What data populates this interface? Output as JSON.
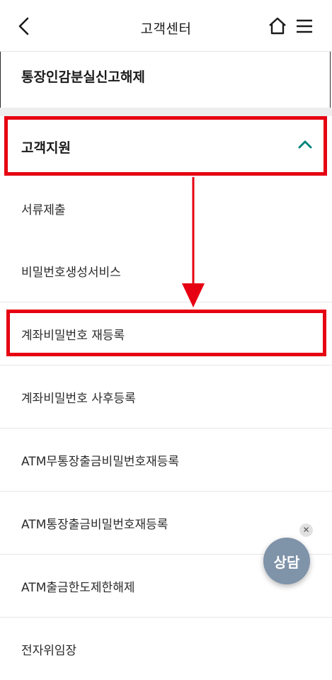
{
  "header": {
    "title": "고객센터",
    "back_icon": "chevron-left-icon",
    "home_icon": "home-icon",
    "menu_icon": "hamburger-menu-icon"
  },
  "previous_item": {
    "label": "통장인감분실신고해제"
  },
  "section": {
    "title": "고객지원",
    "toggle_icon": "chevron-up-icon",
    "accent_color": "#00857c"
  },
  "items": [
    {
      "label": "서류제출"
    },
    {
      "label": "비밀번호생성서비스"
    },
    {
      "label": "계좌비밀번호 재등록"
    },
    {
      "label": "계좌비밀번호 사후등록"
    },
    {
      "label": "ATM무통장출금비밀번호재등록"
    },
    {
      "label": "ATM통장출금비밀번호재등록"
    },
    {
      "label": "ATM출금한도제한해제"
    },
    {
      "label": "전자위임장"
    }
  ],
  "annotation": {
    "color": "#e60012"
  },
  "floating": {
    "chat_label": "상담",
    "close_symbol": "✕"
  }
}
